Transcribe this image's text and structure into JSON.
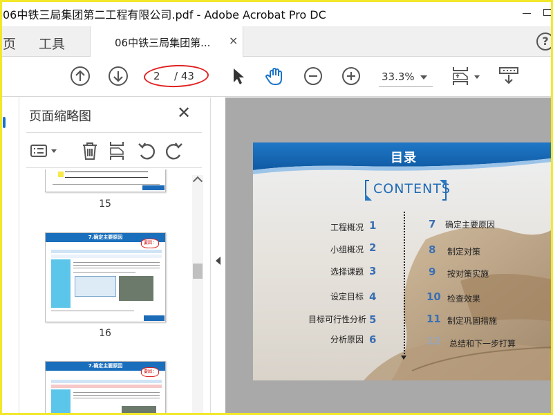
{
  "window": {
    "title": "06中铁三局集团第二工程有限公司.pdf - Adobe Acrobat Pro DC"
  },
  "tabs": {
    "home_label": "页",
    "tools_label": "工具",
    "document_tab_label": "06中铁三局集团第...",
    "close_symbol": "×",
    "help_symbol": "?"
  },
  "toolbar": {
    "current_page": "2",
    "page_total": "/ 43",
    "zoom": "33.3%"
  },
  "thumbnails_panel": {
    "title": "页面缩略图",
    "close_symbol": "✕",
    "pages": [
      {
        "number": "15"
      },
      {
        "number": "16",
        "header": "7.确定主要原因",
        "burst": "要因："
      },
      {
        "header": "7.确定主要原因",
        "burst": "要因："
      }
    ]
  },
  "slide": {
    "title": "目录",
    "contents_label": "CONTENTS",
    "toc_left": [
      {
        "label": "工程概况",
        "num": "1"
      },
      {
        "label": "小组概况",
        "num": "2"
      },
      {
        "label": "选择课题",
        "num": "3"
      },
      {
        "label": "设定目标",
        "num": "4"
      },
      {
        "label": "目标可行性分析",
        "num": "5"
      },
      {
        "label": "分析原因",
        "num": "6"
      }
    ],
    "toc_right": [
      {
        "num": "7",
        "label": "确定主要原因"
      },
      {
        "num": "8",
        "label": "制定对策"
      },
      {
        "num": "9",
        "label": "按对策实施"
      },
      {
        "num": "10",
        "label": "检查效果"
      },
      {
        "num": "11",
        "label": "制定巩固措施"
      },
      {
        "num": "12",
        "label": "总结和下一步打算"
      }
    ]
  },
  "colors": {
    "accent_blue": "#1a6fbd",
    "annotation_red": "#e02020",
    "window_border": "#f2e829"
  },
  "icons": {
    "toolbar": [
      "prev-page-icon",
      "next-page-icon",
      "select-arrow-icon",
      "hand-tool-icon",
      "zoom-out-icon",
      "zoom-in-icon",
      "fit-page-icon",
      "scroll-mode-icon"
    ],
    "panel": [
      "options-icon",
      "delete-icon",
      "insert-page-icon",
      "undo-rotate-icon",
      "redo-rotate-icon"
    ]
  }
}
